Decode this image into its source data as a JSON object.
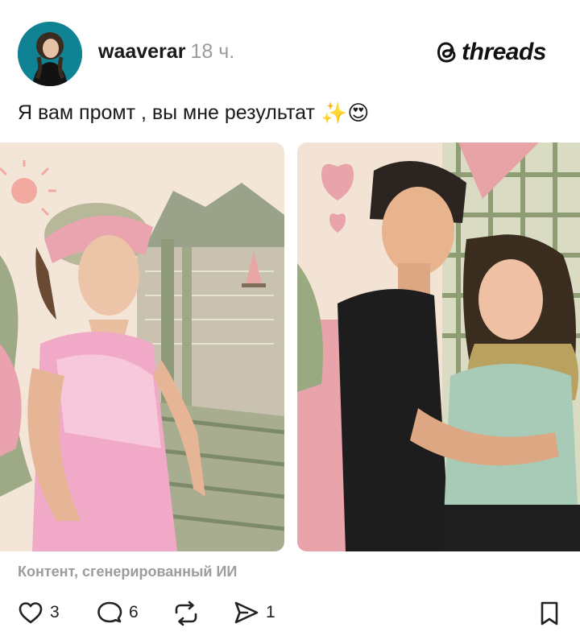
{
  "post": {
    "username": "waaverar",
    "time_ago": "18 ч.",
    "caption_text": "Я вам промт , вы мне результат",
    "caption_emojis": "✨😍",
    "ai_label": "Контент, сгенерированный ИИ"
  },
  "brand": {
    "name": "threads"
  },
  "actions": {
    "likes": "3",
    "replies": "6",
    "shares": "1"
  },
  "icons": {
    "brand": "threads-logo-icon",
    "like": "heart-icon",
    "reply": "comment-bubble-icon",
    "repost": "repost-icon",
    "share": "send-icon",
    "save": "bookmark-icon"
  },
  "colors": {
    "text": "#1a1a1a",
    "muted": "#9b9b9b",
    "avatar_bg": "#0f7d8f"
  }
}
